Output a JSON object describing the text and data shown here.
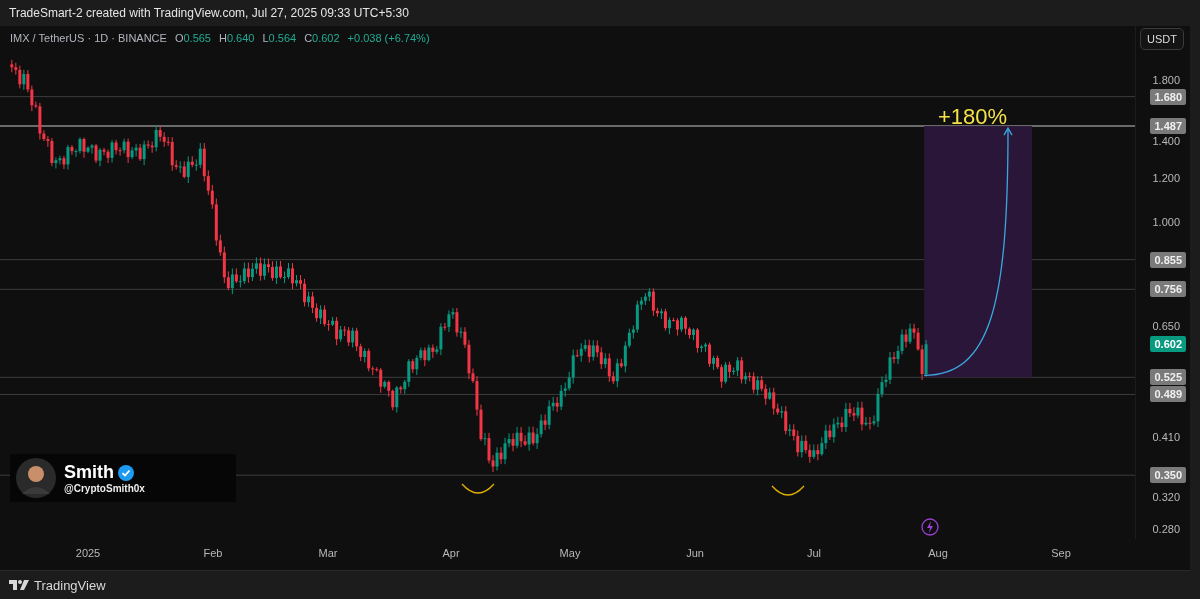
{
  "header": {
    "title": "TradeSmart-2 created with TradingView.com, Jul 27, 2025 09:33 UTC+5:30"
  },
  "legend": {
    "symbol": "IMX / TetherUS · 1D · BINANCE",
    "ohlc": [
      {
        "label": "O",
        "value": "0.565"
      },
      {
        "label": "H",
        "value": "0.640"
      },
      {
        "label": "L",
        "value": "0.564"
      },
      {
        "label": "C",
        "value": "0.602"
      }
    ],
    "change": "+0.038 (+6.74%)"
  },
  "currency_button": "USDT",
  "price_axis": {
    "ticks": [
      "1.800",
      "1.400",
      "1.200",
      "1.000",
      "0.650",
      "0.410",
      "0.320",
      "0.280"
    ],
    "lines": [
      {
        "label": "1.680",
        "kind": "level"
      },
      {
        "label": "1.487",
        "kind": "target"
      },
      {
        "label": "0.855",
        "kind": "level"
      },
      {
        "label": "0.756",
        "kind": "level"
      },
      {
        "label": "0.602",
        "kind": "last"
      },
      {
        "label": "0.525",
        "kind": "level"
      },
      {
        "label": "0.489",
        "kind": "level"
      },
      {
        "label": "0.350",
        "kind": "level"
      }
    ]
  },
  "time_axis": [
    "2025",
    "Feb",
    "Mar",
    "Apr",
    "May",
    "Jun",
    "Jul",
    "Aug",
    "Sep"
  ],
  "annotation": {
    "gain": "+180%"
  },
  "author": {
    "name": "Smith",
    "handle": "@CryptoSmith0x"
  },
  "footer": {
    "brand": "TradingView"
  }
}
